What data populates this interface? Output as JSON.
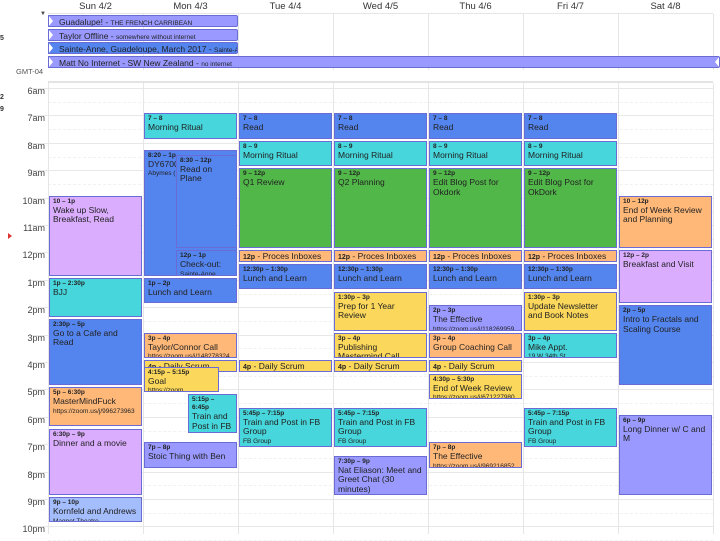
{
  "calendar": {
    "timezone_label": "GMT-04",
    "days": [
      "Sun 4/2",
      "Mon 4/3",
      "Tue 4/4",
      "Wed 4/5",
      "Thu 4/6",
      "Fri 4/7",
      "Sat 4/8"
    ],
    "hours": [
      "6am",
      "7am",
      "8am",
      "9am",
      "10am",
      "11am",
      "12pm",
      "1pm",
      "2pm",
      "3pm",
      "4pm",
      "5pm",
      "6pm",
      "7pm",
      "8pm",
      "9pm",
      "10pm"
    ],
    "all_day_events": [
      {
        "title": "Guadalupe! - ",
        "sub": "THE FRENCH CARRIBEAN",
        "color": "#9999ff"
      },
      {
        "title": "Taylor Offline - ",
        "sub": "somewhere without internet",
        "color": "#9999ff"
      },
      {
        "title": "Sainte-Anne, Guadeloupe, March 2017 - ",
        "sub": "Sainte-Ann",
        "color": "#5484ed"
      },
      {
        "title": "Matt No Internet - SW New Zealand - ",
        "sub": "no internet",
        "color": "#9999ff"
      }
    ],
    "events": [
      {
        "day": 0,
        "time": "10 – 1p",
        "title": "Wake up Slow, Breakfast, Read",
        "color": "#dbadff"
      },
      {
        "day": 0,
        "time": "1p – 2:30p",
        "title": "BJJ",
        "color": "#46d6db"
      },
      {
        "day": 0,
        "time": "2:30p – 5p",
        "title": "Go to a Cafe and Read",
        "color": "#5484ed"
      },
      {
        "day": 0,
        "time": "5p – 6:30p",
        "title": "MasterMindFuck",
        "loc": "https://zoom.us/j/996273963",
        "color": "#ffb878"
      },
      {
        "day": 0,
        "time": "6:30p – 9p",
        "title": "Dinner and a movie",
        "color": "#dbadff"
      },
      {
        "day": 0,
        "time": "9p – 10p",
        "title": "Kornfeld and Andrews",
        "loc": "Magnet Theatre",
        "color": "#a4bdfc"
      },
      {
        "day": 1,
        "time": "7 – 8",
        "title": "Morning Ritual",
        "color": "#46d6db"
      },
      {
        "day": 1,
        "time": "8:20 – 1p",
        "title": "DY6700 PT JFK",
        "loc": "Abymes (PTP",
        "color": "#5484ed"
      },
      {
        "day": 1,
        "time": "8:30 – 12p",
        "title": "Read on Plane",
        "color": "#5484ed"
      },
      {
        "day": 1,
        "time": "12p – 1p",
        "title": "Check-out:",
        "loc": "Sainte-Anne,",
        "color": "#5484ed"
      },
      {
        "day": 1,
        "time": "1p – 2p",
        "title": "Lunch and Learn",
        "color": "#5484ed"
      },
      {
        "day": 1,
        "time": "3p – 4p",
        "title": "Taylor/Connor Call",
        "loc": "https://zoom.us/j/148278324",
        "color": "#ffb878"
      },
      {
        "day": 1,
        "time": "4p",
        "title": " - Daily Scrum",
        "color": "#fbd75b"
      },
      {
        "day": 1,
        "time": "4:15p – 5:15p",
        "title": "Goal",
        "loc": "https://zoom.",
        "color": "#fbd75b"
      },
      {
        "day": 1,
        "time": "5:15p – 6:45p",
        "title": "Train and Post in FB Group",
        "loc": "FB Group",
        "color": "#46d6db"
      },
      {
        "day": 1,
        "time": "7p – 8p",
        "title": "Stoic Thing with Ben",
        "color": "#9999ff"
      },
      {
        "day": 2,
        "time": "7 – 8",
        "title": "Read",
        "color": "#5484ed"
      },
      {
        "day": 2,
        "time": "8 – 9",
        "title": "Morning Ritual",
        "color": "#46d6db"
      },
      {
        "day": 2,
        "time": "9 – 12p",
        "title": "Q1 Review",
        "color": "#51b749"
      },
      {
        "day": 2,
        "time": "12p",
        "title": " - Proces Inboxes",
        "color": "#ffb878"
      },
      {
        "day": 2,
        "time": "12:30p – 1:30p",
        "title": "Lunch and Learn",
        "color": "#5484ed"
      },
      {
        "day": 2,
        "time": "4p",
        "title": " - Daily Scrum",
        "color": "#fbd75b"
      },
      {
        "day": 2,
        "time": "5:45p – 7:15p",
        "title": "Train and Post in FB Group",
        "loc": "FB Group",
        "color": "#46d6db"
      },
      {
        "day": 3,
        "time": "7 – 8",
        "title": "Read",
        "color": "#5484ed"
      },
      {
        "day": 3,
        "time": "8 – 9",
        "title": "Morning Ritual",
        "color": "#46d6db"
      },
      {
        "day": 3,
        "time": "9 – 12p",
        "title": "Q2 Planning",
        "color": "#51b749"
      },
      {
        "day": 3,
        "time": "12p",
        "title": " - Proces Inboxes",
        "color": "#ffb878"
      },
      {
        "day": 3,
        "time": "12:30p – 1:30p",
        "title": "Lunch and Learn",
        "color": "#5484ed"
      },
      {
        "day": 3,
        "time": "1:30p – 3p",
        "title": "Prep for 1 Year Review",
        "color": "#fbd75b"
      },
      {
        "day": 3,
        "time": "3p – 4p",
        "title": "Publishing Mastermind Call",
        "color": "#fbd75b"
      },
      {
        "day": 3,
        "time": "4p",
        "title": " - Daily Scrum",
        "color": "#fbd75b"
      },
      {
        "day": 3,
        "time": "5:45p – 7:15p",
        "title": "Train and Post in FB Group",
        "loc": "FB Group",
        "color": "#46d6db"
      },
      {
        "day": 3,
        "time": "7:30p – 9p",
        "title": "Nat Eliason: Meet and Greet Chat (30 minutes)",
        "color": "#9999ff"
      },
      {
        "day": 4,
        "time": "7 – 8",
        "title": "Read",
        "color": "#5484ed"
      },
      {
        "day": 4,
        "time": "8 – 9",
        "title": "Morning Ritual",
        "color": "#46d6db"
      },
      {
        "day": 4,
        "time": "9 – 12p",
        "title": "Edit Blog Post for Okdork",
        "color": "#51b749"
      },
      {
        "day": 4,
        "time": "12p",
        "title": " - Proces Inboxes",
        "color": "#ffb878"
      },
      {
        "day": 4,
        "time": "12:30p – 1:30p",
        "title": "Lunch and Learn",
        "color": "#5484ed"
      },
      {
        "day": 4,
        "time": "2p – 3p",
        "title": "The Effective",
        "loc": "https://zoom.us/j/118269959",
        "color": "#9999ff"
      },
      {
        "day": 4,
        "time": "3p – 4p",
        "title": "Group Coaching Call",
        "color": "#ffb878"
      },
      {
        "day": 4,
        "time": "4p",
        "title": " - Daily Scrum",
        "color": "#fbd75b"
      },
      {
        "day": 4,
        "time": "4:30p – 5:30p",
        "title": "End of Week Review",
        "loc": "https://zoom.us/j/671227980",
        "color": "#fbd75b"
      },
      {
        "day": 4,
        "time": "7p – 8p",
        "title": "The Effective",
        "loc": "https://zoom.us/j/969216852",
        "color": "#ffb878"
      },
      {
        "day": 5,
        "time": "7 – 8",
        "title": "Read",
        "color": "#5484ed"
      },
      {
        "day": 5,
        "time": "8 – 9",
        "title": "Morning Ritual",
        "color": "#46d6db"
      },
      {
        "day": 5,
        "time": "9 – 12p",
        "title": "Edit Blog Post for OkDork",
        "color": "#51b749"
      },
      {
        "day": 5,
        "time": "12p",
        "title": " - Proces Inboxes",
        "color": "#ffb878"
      },
      {
        "day": 5,
        "time": "12:30p – 1:30p",
        "title": "Lunch and Learn",
        "color": "#5484ed"
      },
      {
        "day": 5,
        "time": "1:30p – 3p",
        "title": "Update Newsletter and Book Notes",
        "color": "#fbd75b"
      },
      {
        "day": 5,
        "time": "3p – 4p",
        "title": "Mike Appt.",
        "loc": "19 W 34th St",
        "color": "#46d6db"
      },
      {
        "day": 5,
        "time": "5:45p – 7:15p",
        "title": "Train and Post in FB Group",
        "loc": "FB Group",
        "color": "#46d6db"
      },
      {
        "day": 6,
        "time": "10 – 12p",
        "title": "End of Week Review and Planning",
        "color": "#ffb878"
      },
      {
        "day": 6,
        "time": "12p – 2p",
        "title": "Breakfast and Visit",
        "color": "#dbadff"
      },
      {
        "day": 6,
        "time": "2p – 5p",
        "title": "Intro to Fractals and Scaling Course",
        "color": "#5484ed"
      },
      {
        "day": 6,
        "time": "6p – 9p",
        "title": "Long Dinner w/ C and M",
        "color": "#9999ff"
      }
    ]
  },
  "left_strip": [
    "5",
    "2",
    "9"
  ]
}
